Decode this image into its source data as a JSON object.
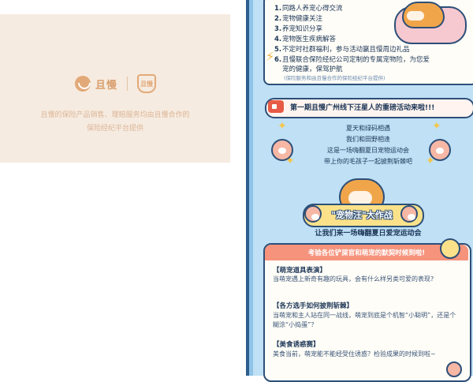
{
  "footer": {
    "brand_name": "且慢",
    "badge_text": "且慢",
    "disclaimer_line1": "且慢的保险产品销售、理赔服务均由且慢合作的",
    "disclaimer_line2": "保险经纪平台提供"
  },
  "poster": {
    "benefits": [
      {
        "num": "1.",
        "text": "同路人养宠心得交流"
      },
      {
        "num": "2.",
        "text": "宠物健康关注"
      },
      {
        "num": "3.",
        "text": "养宠知识分享"
      },
      {
        "num": "4.",
        "text": "宠物医生疾病解答"
      },
      {
        "num": "5.",
        "text": "不定时社群福利，参与活动赢且慢周边礼品"
      },
      {
        "num": "6.",
        "text": "且慢联合保险经纪公司定制的专属宠物险，为您爱"
      },
      {
        "num": "",
        "text": "宠的健康，保驾护航"
      }
    ],
    "benefit_note": "(保险服务和由且慢合作的保险经纪平台提供)",
    "event_title": "第一期且慢广州线下汪星人的重磅活动来啦!!!",
    "intro_lines": [
      "夏天和绿码相遇",
      "我们和田野相逢",
      "这是一场嗨翻夏日宠物运动会",
      "带上你的毛孩子一起披荆斩棘吧"
    ],
    "banner_text": "\"宠物汪\"大作战",
    "subtitle": "让我们来一场嗨翻夏日爱宠运动会",
    "section_header": "考验各位铲屎官和萌宠的默契时候到啦!",
    "questions": [
      {
        "title": "【萌宠道具表演】",
        "body": "当萌宠遇上新奇有趣的玩具，会有什么样另类可爱的表现?"
      },
      {
        "title": "【各方选手如何披荆斩棘】",
        "body": "当萌宠和主人站在同一战线，萌宠到底是个机智“小聪明”，还是个糊涂“小捣蛋”？"
      },
      {
        "title": "【美食诱惑赛】",
        "body": "美食当前，萌宠能不能经受住诱惑？检验成果的时候到啦~"
      }
    ]
  }
}
